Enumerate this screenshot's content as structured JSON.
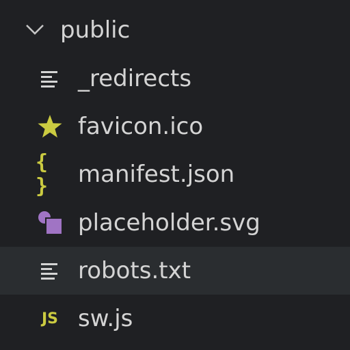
{
  "folder": {
    "label": "public",
    "icon": "chevron-down-icon",
    "expanded": true
  },
  "files": [
    {
      "label": "_redirects",
      "icon": "lines-icon",
      "icon_color": "#d4d4d4"
    },
    {
      "label": "favicon.ico",
      "icon": "star-icon",
      "icon_color": "#cbcb41"
    },
    {
      "label": "manifest.json",
      "icon": "braces-icon",
      "icon_glyph": "{ }",
      "icon_color": "#cbcb41"
    },
    {
      "label": "placeholder.svg",
      "icon": "svg-shapes-icon",
      "icon_color": "#a074c4"
    },
    {
      "label": "robots.txt",
      "icon": "lines-icon",
      "icon_color": "#d4d4d4",
      "selected": true
    },
    {
      "label": "sw.js",
      "icon": "js-icon",
      "icon_glyph": "JS",
      "icon_color": "#cbcb41"
    }
  ],
  "colors": {
    "background": "#1f2023",
    "selected_row": "#2a2d30",
    "text": "#d4d4d4"
  }
}
